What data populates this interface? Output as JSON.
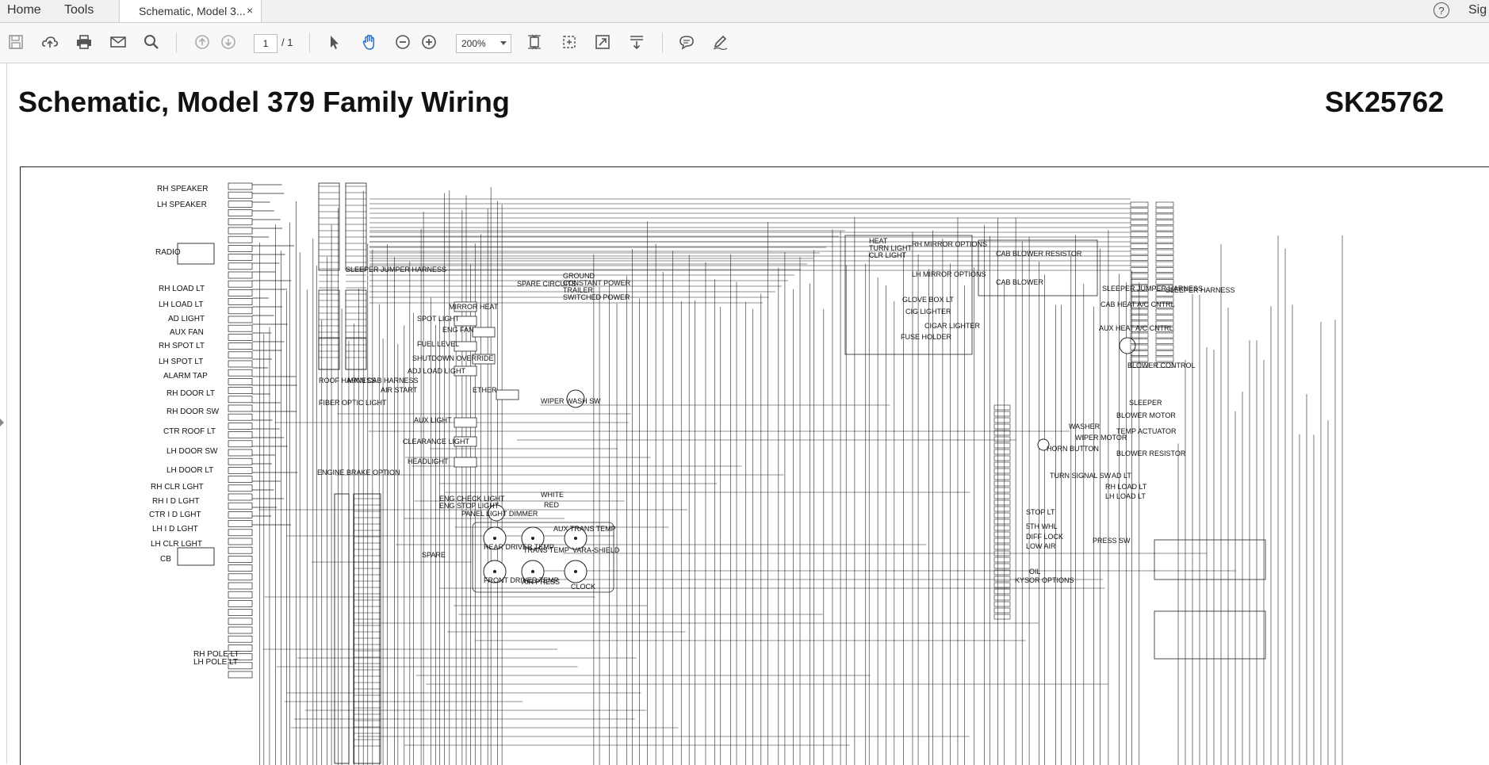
{
  "menubar": {
    "home": "Home",
    "tools": "Tools",
    "tab_title": "Schematic, Model 3...",
    "close": "×",
    "help": "?",
    "sign": "Sig"
  },
  "toolbar": {
    "page_current": "1",
    "page_total": "/ 1",
    "zoom": "200%"
  },
  "document": {
    "title": "Schematic, Model 379 Family Wiring",
    "id": "SK25762"
  },
  "labels": [
    {
      "t": "RH SPEAKER"
    },
    {
      "t": "LH SPEAKER"
    },
    {
      "t": "RADIO"
    },
    {
      "t": "RH LOAD LT"
    },
    {
      "t": "LH LOAD LT"
    },
    {
      "t": "AD LIGHT"
    },
    {
      "t": "AUX FAN"
    },
    {
      "t": "RH SPOT LT"
    },
    {
      "t": "LH SPOT LT"
    },
    {
      "t": "ALARM TAP"
    },
    {
      "t": "RH DOOR LT"
    },
    {
      "t": "RH DOOR SW"
    },
    {
      "t": "CTR ROOF LT"
    },
    {
      "t": "LH DOOR SW"
    },
    {
      "t": "LH DOOR LT"
    },
    {
      "t": "RH CLR LGHT"
    },
    {
      "t": "RH I D LGHT"
    },
    {
      "t": "CTR I D LGHT"
    },
    {
      "t": "LH I D LGHT"
    },
    {
      "t": "LH CLR LGHT"
    },
    {
      "t": "CB"
    },
    {
      "t": "RH POLE LT"
    },
    {
      "t": "LH POLE LT"
    },
    {
      "t": "SLEEPER JUMPER HARNESS"
    },
    {
      "t": "ROOF HARNESS"
    },
    {
      "t": "MAIN CAB HARNESS"
    },
    {
      "t": "SPARE CIRCUITS"
    },
    {
      "t": "GROUND"
    },
    {
      "t": "CONSTANT POWER"
    },
    {
      "t": "TRAILER"
    },
    {
      "t": "SWITCHED POWER"
    },
    {
      "t": "MIRROR HEAT"
    },
    {
      "t": "SPOT LIGHT"
    },
    {
      "t": "ENG FAN"
    },
    {
      "t": "FUEL LEVEL"
    },
    {
      "t": "SHUTDOWN OVERRIDE"
    },
    {
      "t": "ADJ LOAD LIGHT"
    },
    {
      "t": "AIR START"
    },
    {
      "t": "ETHER"
    },
    {
      "t": "WIPER WASH SW"
    },
    {
      "t": "FIBER OPTIC LIGHT"
    },
    {
      "t": "AUX LIGHT"
    },
    {
      "t": "CLEARANCE LIGHT"
    },
    {
      "t": "HEADLIGHT"
    },
    {
      "t": "ENGINE BRAKE OPTION"
    },
    {
      "t": "ENG CHECK LIGHT"
    },
    {
      "t": "ENG STOP LIGHT"
    },
    {
      "t": "PANEL LIGHT DIMMER"
    },
    {
      "t": "WHITE"
    },
    {
      "t": "RED"
    },
    {
      "t": "AUX TRANS TEMP"
    },
    {
      "t": "REAR DRIVER TEMP"
    },
    {
      "t": "TRANS TEMP"
    },
    {
      "t": "VARA-SHIELD"
    },
    {
      "t": "FRONT DRIVER TEMP"
    },
    {
      "t": "AIR PRESS"
    },
    {
      "t": "CLOCK"
    },
    {
      "t": "SPARE"
    },
    {
      "t": "RH MIRROR OPTIONS"
    },
    {
      "t": "LH MIRROR OPTIONS"
    },
    {
      "t": "HEAT"
    },
    {
      "t": "TURN LIGHT"
    },
    {
      "t": "CLR LIGHT"
    },
    {
      "t": "GLOVE BOX LT"
    },
    {
      "t": "CIG LIGHTER"
    },
    {
      "t": "CIGAR LIGHTER"
    },
    {
      "t": "FUSE HOLDER"
    },
    {
      "t": "CAB BLOWER RESISTOR"
    },
    {
      "t": "CAB BLOWER"
    },
    {
      "t": "SLEEPER JUMPER HARNESS"
    },
    {
      "t": "SLEEPER HARNESS"
    },
    {
      "t": "CAB HEAT A/C CNTRL"
    },
    {
      "t": "AUX HEAT A/C CNTRL"
    },
    {
      "t": "BLOWER CONTROL"
    },
    {
      "t": "WASHER"
    },
    {
      "t": "WIPER MOTOR"
    },
    {
      "t": "HORN BUTTON"
    },
    {
      "t": "TURN SIGNAL SW"
    },
    {
      "t": "STOP LT"
    },
    {
      "t": "5TH WHL"
    },
    {
      "t": "DIFF LOCK"
    },
    {
      "t": "LOW AIR"
    },
    {
      "t": "PRESS SW"
    },
    {
      "t": "OIL"
    },
    {
      "t": "KYSOR OPTIONS"
    },
    {
      "t": "SLEEPER"
    },
    {
      "t": "BLOWER MOTOR"
    },
    {
      "t": "TEMP ACTUATOR"
    },
    {
      "t": "BLOWER RESISTOR"
    },
    {
      "t": "AD LT"
    },
    {
      "t": "RH LOAD LT"
    },
    {
      "t": "LH LOAD LT"
    }
  ]
}
